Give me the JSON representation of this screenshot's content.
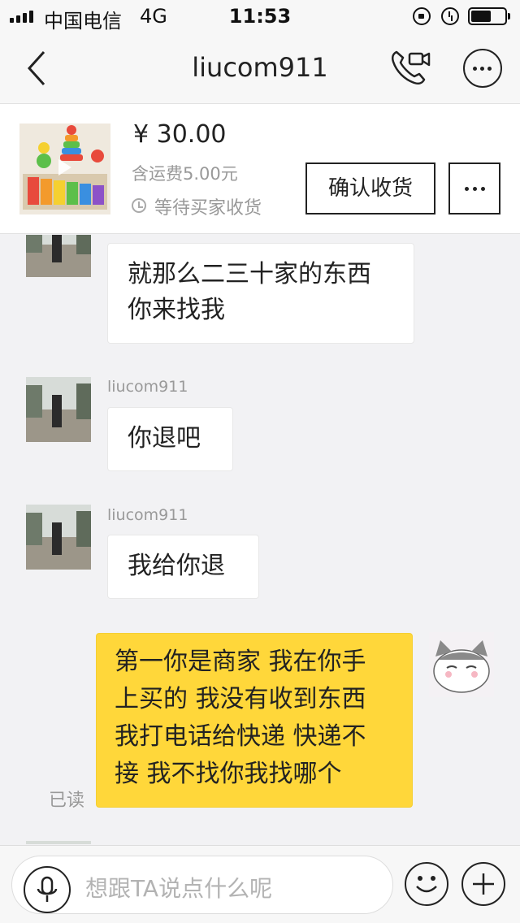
{
  "status_bar": {
    "carrier": "中国电信",
    "network": "4G",
    "time": "11:53"
  },
  "nav": {
    "title": "liucom911",
    "icons": [
      "back-chevron-icon",
      "voice-video-call-icon",
      "more-icon"
    ]
  },
  "product": {
    "price": "¥ 30.00",
    "shipping": "含运费5.00元",
    "status": "等待买家收货",
    "confirm_label": "确认收货",
    "more_label": "···"
  },
  "messages": [
    {
      "side": "other",
      "sender": "",
      "lines": [
        "就那么二三十家的东西",
        "你来找我"
      ]
    },
    {
      "side": "other",
      "sender": "liucom911",
      "lines": [
        "你退吧"
      ]
    },
    {
      "side": "other",
      "sender": "liucom911",
      "lines": [
        "我给你退"
      ]
    },
    {
      "side": "self",
      "read_label": "已读",
      "lines": [
        "第一你是商家 我在你手",
        "上买的 我没有收到东西",
        "我打电话给快递 快递不",
        "接 我不找你我找哪个"
      ]
    }
  ],
  "input": {
    "placeholder": "想跟TA说点什么呢"
  },
  "colors": {
    "self_bubble": "#ffd73a",
    "background": "#f2f2f4"
  }
}
